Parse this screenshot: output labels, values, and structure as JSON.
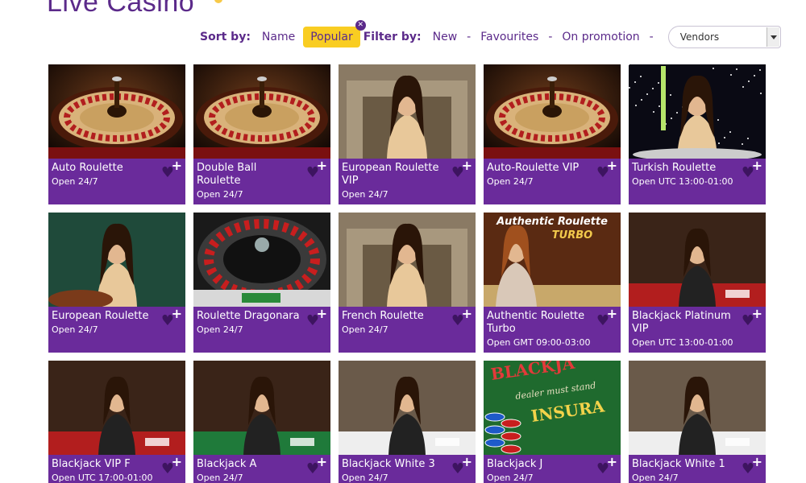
{
  "page": {
    "title": "Live Casino"
  },
  "sort": {
    "label": "Sort by:",
    "name": "Name",
    "popular": "Popular"
  },
  "filter": {
    "label": "Filter by:",
    "new": "New",
    "favourites": "Favourites",
    "on_promotion": "On promotion",
    "vendors_value": "Vendors",
    "separator": "-"
  },
  "colors": {
    "brand_purple": "#6a2b9b",
    "accent_yellow": "#f9cd22",
    "heart": "#3d1460"
  },
  "games": [
    {
      "name": "Auto Roulette",
      "hours": "Open 24/7",
      "thumb": "roulette-wheel"
    },
    {
      "name": "Double Ball Roulette",
      "hours": "Open 24/7",
      "thumb": "roulette-wheel"
    },
    {
      "name": "European Roulette VIP",
      "hours": "Open 24/7",
      "thumb": "dealer-fireplace"
    },
    {
      "name": "Auto-Roulette VIP",
      "hours": "Open 24/7",
      "thumb": "roulette-wheel"
    },
    {
      "name": "Turkish Roulette",
      "hours": "Open UTC 13:00-01:00",
      "thumb": "dealer-stars"
    },
    {
      "name": "European Roulette",
      "hours": "Open 24/7",
      "thumb": "dealer-green"
    },
    {
      "name": "Roulette Dragonara",
      "hours": "Open 24/7",
      "thumb": "roulette-top"
    },
    {
      "name": "French Roulette",
      "hours": "Open 24/7",
      "thumb": "dealer-fireplace"
    },
    {
      "name": "Authentic Roulette Turbo",
      "hours": "Open GMT 09:00-03:00",
      "thumb": "authentic-turbo",
      "overlay_line1": "Authentic Roulette",
      "overlay_line2": "TURBO"
    },
    {
      "name": "Blackjack Platinum VIP",
      "hours": "Open UTC 13:00-01:00",
      "thumb": "blackjack-red"
    },
    {
      "name": "Blackjack VIP F",
      "hours": "Open UTC 17:00-01:00",
      "thumb": "blackjack-red"
    },
    {
      "name": "Blackjack A",
      "hours": "Open 24/7",
      "thumb": "blackjack-green"
    },
    {
      "name": "Blackjack White 3",
      "hours": "Open 24/7",
      "thumb": "blackjack-white"
    },
    {
      "name": "Blackjack J",
      "hours": "Open 24/7",
      "thumb": "blackjack-felt",
      "overlay_line1": "BLACKJA",
      "overlay_line2": "INSURA",
      "overlay_line3": "dealer must stand"
    },
    {
      "name": "Blackjack White 1",
      "hours": "Open 24/7",
      "thumb": "blackjack-white"
    }
  ]
}
